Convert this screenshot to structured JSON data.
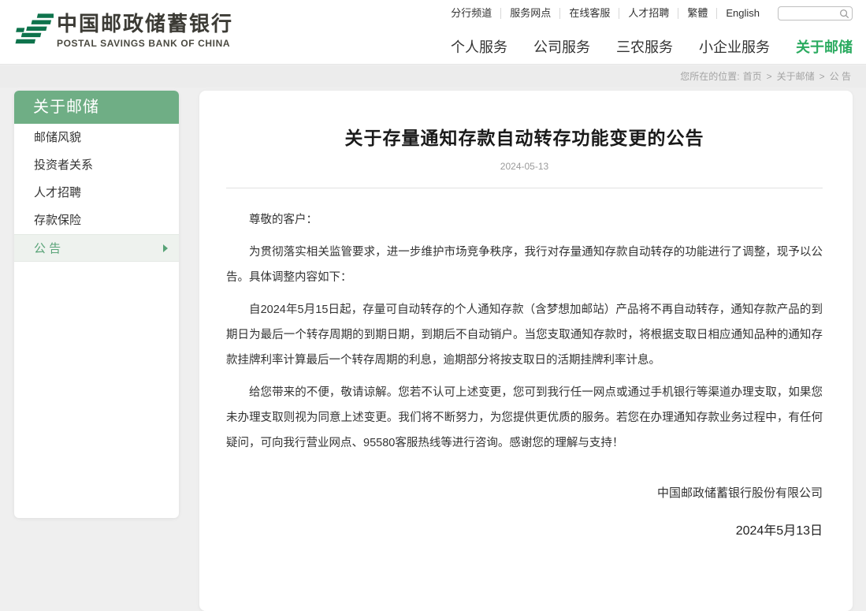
{
  "header": {
    "logo": {
      "cn": "中国邮政储蓄银行",
      "en": "POSTAL SAVINGS BANK OF CHINA"
    },
    "utility_links": [
      "分行频道",
      "服务网点",
      "在线客服",
      "人才招聘",
      "繁體",
      "English"
    ],
    "search": {
      "placeholder": "",
      "value": ""
    },
    "nav": [
      {
        "label": "个人服务",
        "active": false
      },
      {
        "label": "公司服务",
        "active": false
      },
      {
        "label": "三农服务",
        "active": false
      },
      {
        "label": "小企业服务",
        "active": false
      },
      {
        "label": "关于邮储",
        "active": true
      }
    ]
  },
  "breadcrumb": {
    "prefix": "您所在的位置:",
    "items": [
      "首页",
      "关于邮储",
      "公 告"
    ],
    "separator": ">"
  },
  "sidebar": {
    "title": "关于邮储",
    "items": [
      {
        "label": "邮储风貌",
        "active": false
      },
      {
        "label": "投资者关系",
        "active": false
      },
      {
        "label": "人才招聘",
        "active": false
      },
      {
        "label": "存款保险",
        "active": false
      },
      {
        "label": "公 告",
        "active": true
      }
    ]
  },
  "article": {
    "title": "关于存量通知存款自动转存功能变更的公告",
    "date": "2024-05-13",
    "paragraphs": [
      "尊敬的客户：",
      "为贯彻落实相关监管要求，进一步维护市场竞争秩序，我行对存量通知存款自动转存的功能进行了调整，现予以公告。具体调整内容如下：",
      "自2024年5月15日起，存量可自动转存的个人通知存款（含梦想加邮站）产品将不再自动转存，通知存款产品的到期日为最后一个转存周期的到期日期，到期后不自动销户。当您支取通知存款时，将根据支取日相应通知品种的通知存款挂牌利率计算最后一个转存周期的利息，逾期部分将按支取日的活期挂牌利率计息。",
      "给您带来的不便，敬请谅解。您若不认可上述变更，您可到我行任一网点或通过手机银行等渠道办理支取，如果您未办理支取则视为同意上述变更。我们将不断努力，为您提供更优质的服务。若您在办理通知存款业务过程中，有任何疑问，可向我行营业网点、95580客服热线等进行咨询。感谢您的理解与支持！"
    ],
    "signature": "中国邮政储蓄银行股份有限公司",
    "sign_date": "2024年5月13日"
  },
  "icons": {
    "logo": "psbc-emblem",
    "search": "magnifier",
    "sidebar_active": "triangle-right"
  },
  "colors": {
    "brand_green": "#0e734c",
    "nav_active_green": "#2bab60",
    "sidebar_header_green": "#6fae85",
    "sidebar_active_green": "#58a377",
    "page_background": "#efefef",
    "card_background": "#ffffff"
  }
}
